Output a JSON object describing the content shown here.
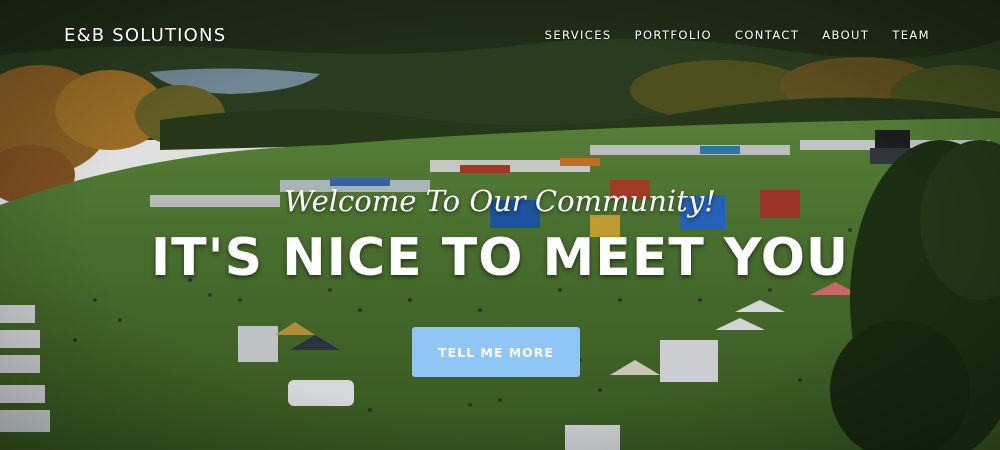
{
  "brand": {
    "name": "E&B SOLUTIONS"
  },
  "nav": {
    "items": [
      {
        "label": "SERVICES"
      },
      {
        "label": "PORTFOLIO"
      },
      {
        "label": "CONTACT"
      },
      {
        "label": "ABOUT"
      },
      {
        "label": "TEAM"
      }
    ]
  },
  "hero": {
    "intro": "Welcome To Our Community!",
    "heading": "IT'S NICE TO MEET YOU",
    "cta_label": "TELL ME MORE",
    "background_image": "aerial-photo-of-outdoor-community-festival"
  },
  "colors": {
    "cta_background": "#8fc6f5",
    "text": "#ffffff",
    "field": "#4f7a34",
    "forest": "#2f4a1c"
  }
}
